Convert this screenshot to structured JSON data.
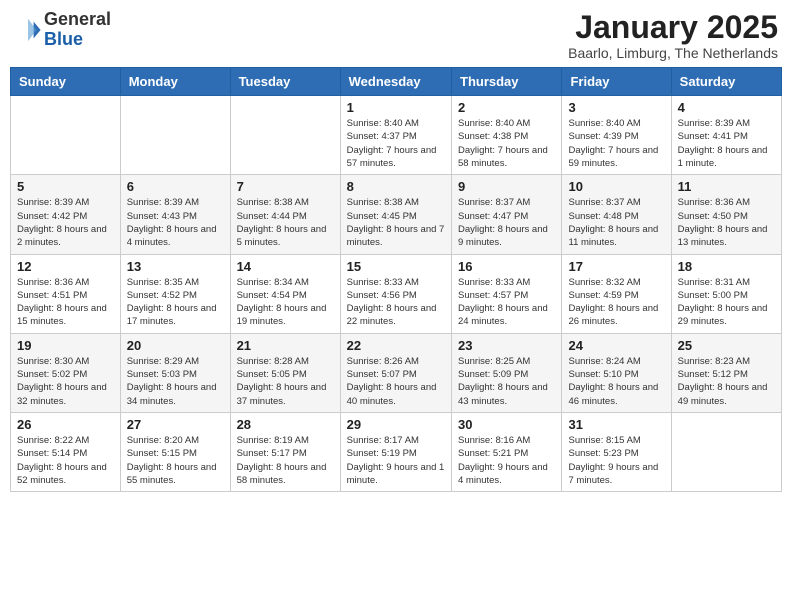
{
  "header": {
    "logo_general": "General",
    "logo_blue": "Blue",
    "title": "January 2025",
    "subtitle": "Baarlo, Limburg, The Netherlands"
  },
  "columns": [
    "Sunday",
    "Monday",
    "Tuesday",
    "Wednesday",
    "Thursday",
    "Friday",
    "Saturday"
  ],
  "weeks": [
    [
      {
        "day": "",
        "detail": ""
      },
      {
        "day": "",
        "detail": ""
      },
      {
        "day": "",
        "detail": ""
      },
      {
        "day": "1",
        "detail": "Sunrise: 8:40 AM\nSunset: 4:37 PM\nDaylight: 7 hours and 57 minutes."
      },
      {
        "day": "2",
        "detail": "Sunrise: 8:40 AM\nSunset: 4:38 PM\nDaylight: 7 hours and 58 minutes."
      },
      {
        "day": "3",
        "detail": "Sunrise: 8:40 AM\nSunset: 4:39 PM\nDaylight: 7 hours and 59 minutes."
      },
      {
        "day": "4",
        "detail": "Sunrise: 8:39 AM\nSunset: 4:41 PM\nDaylight: 8 hours and 1 minute."
      }
    ],
    [
      {
        "day": "5",
        "detail": "Sunrise: 8:39 AM\nSunset: 4:42 PM\nDaylight: 8 hours and 2 minutes."
      },
      {
        "day": "6",
        "detail": "Sunrise: 8:39 AM\nSunset: 4:43 PM\nDaylight: 8 hours and 4 minutes."
      },
      {
        "day": "7",
        "detail": "Sunrise: 8:38 AM\nSunset: 4:44 PM\nDaylight: 8 hours and 5 minutes."
      },
      {
        "day": "8",
        "detail": "Sunrise: 8:38 AM\nSunset: 4:45 PM\nDaylight: 8 hours and 7 minutes."
      },
      {
        "day": "9",
        "detail": "Sunrise: 8:37 AM\nSunset: 4:47 PM\nDaylight: 8 hours and 9 minutes."
      },
      {
        "day": "10",
        "detail": "Sunrise: 8:37 AM\nSunset: 4:48 PM\nDaylight: 8 hours and 11 minutes."
      },
      {
        "day": "11",
        "detail": "Sunrise: 8:36 AM\nSunset: 4:50 PM\nDaylight: 8 hours and 13 minutes."
      }
    ],
    [
      {
        "day": "12",
        "detail": "Sunrise: 8:36 AM\nSunset: 4:51 PM\nDaylight: 8 hours and 15 minutes."
      },
      {
        "day": "13",
        "detail": "Sunrise: 8:35 AM\nSunset: 4:52 PM\nDaylight: 8 hours and 17 minutes."
      },
      {
        "day": "14",
        "detail": "Sunrise: 8:34 AM\nSunset: 4:54 PM\nDaylight: 8 hours and 19 minutes."
      },
      {
        "day": "15",
        "detail": "Sunrise: 8:33 AM\nSunset: 4:56 PM\nDaylight: 8 hours and 22 minutes."
      },
      {
        "day": "16",
        "detail": "Sunrise: 8:33 AM\nSunset: 4:57 PM\nDaylight: 8 hours and 24 minutes."
      },
      {
        "day": "17",
        "detail": "Sunrise: 8:32 AM\nSunset: 4:59 PM\nDaylight: 8 hours and 26 minutes."
      },
      {
        "day": "18",
        "detail": "Sunrise: 8:31 AM\nSunset: 5:00 PM\nDaylight: 8 hours and 29 minutes."
      }
    ],
    [
      {
        "day": "19",
        "detail": "Sunrise: 8:30 AM\nSunset: 5:02 PM\nDaylight: 8 hours and 32 minutes."
      },
      {
        "day": "20",
        "detail": "Sunrise: 8:29 AM\nSunset: 5:03 PM\nDaylight: 8 hours and 34 minutes."
      },
      {
        "day": "21",
        "detail": "Sunrise: 8:28 AM\nSunset: 5:05 PM\nDaylight: 8 hours and 37 minutes."
      },
      {
        "day": "22",
        "detail": "Sunrise: 8:26 AM\nSunset: 5:07 PM\nDaylight: 8 hours and 40 minutes."
      },
      {
        "day": "23",
        "detail": "Sunrise: 8:25 AM\nSunset: 5:09 PM\nDaylight: 8 hours and 43 minutes."
      },
      {
        "day": "24",
        "detail": "Sunrise: 8:24 AM\nSunset: 5:10 PM\nDaylight: 8 hours and 46 minutes."
      },
      {
        "day": "25",
        "detail": "Sunrise: 8:23 AM\nSunset: 5:12 PM\nDaylight: 8 hours and 49 minutes."
      }
    ],
    [
      {
        "day": "26",
        "detail": "Sunrise: 8:22 AM\nSunset: 5:14 PM\nDaylight: 8 hours and 52 minutes."
      },
      {
        "day": "27",
        "detail": "Sunrise: 8:20 AM\nSunset: 5:15 PM\nDaylight: 8 hours and 55 minutes."
      },
      {
        "day": "28",
        "detail": "Sunrise: 8:19 AM\nSunset: 5:17 PM\nDaylight: 8 hours and 58 minutes."
      },
      {
        "day": "29",
        "detail": "Sunrise: 8:17 AM\nSunset: 5:19 PM\nDaylight: 9 hours and 1 minute."
      },
      {
        "day": "30",
        "detail": "Sunrise: 8:16 AM\nSunset: 5:21 PM\nDaylight: 9 hours and 4 minutes."
      },
      {
        "day": "31",
        "detail": "Sunrise: 8:15 AM\nSunset: 5:23 PM\nDaylight: 9 hours and 7 minutes."
      },
      {
        "day": "",
        "detail": ""
      }
    ]
  ]
}
